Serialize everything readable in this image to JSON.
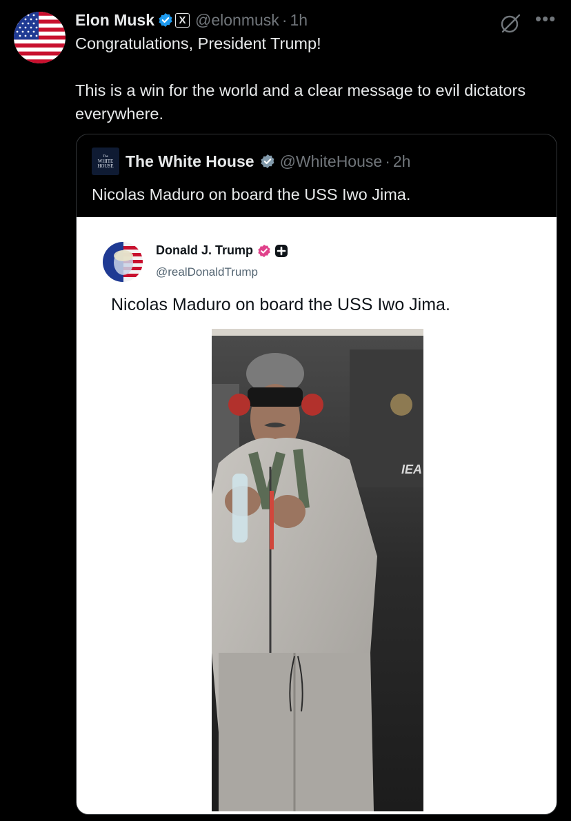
{
  "post": {
    "author_name": "Elon Musk",
    "handle": "@elonmusk",
    "separator": "·",
    "time": "1h",
    "affiliation_badge": "X",
    "text_line1": "Congratulations, President Trump!",
    "text_line2": "This is a win for the world and a clear message to evil dictators everywhere."
  },
  "quote": {
    "author_name": "The White House",
    "handle": "@WhiteHouse",
    "separator": "·",
    "time": "2h",
    "logo_text": [
      "The",
      "WHITE",
      "HOUSE"
    ],
    "text": "Nicolas Maduro on board the USS Iwo Jima."
  },
  "embedded": {
    "author_name": "Donald J. Trump",
    "handle": "@realDonaldTrump",
    "text": "Nicolas Maduro on board the USS Iwo Jima."
  },
  "colors": {
    "background": "#000000",
    "text_primary": "#e7e9ea",
    "text_secondary": "#71767b",
    "verified_blue": "#1d9bf0",
    "verified_gov_gray": "#829aab",
    "truth_social_pink": "#e0428b"
  },
  "icons": [
    "verified-badge-icon",
    "x-affiliation-icon",
    "grok-icon",
    "more-icon",
    "truth-plus-icon"
  ]
}
